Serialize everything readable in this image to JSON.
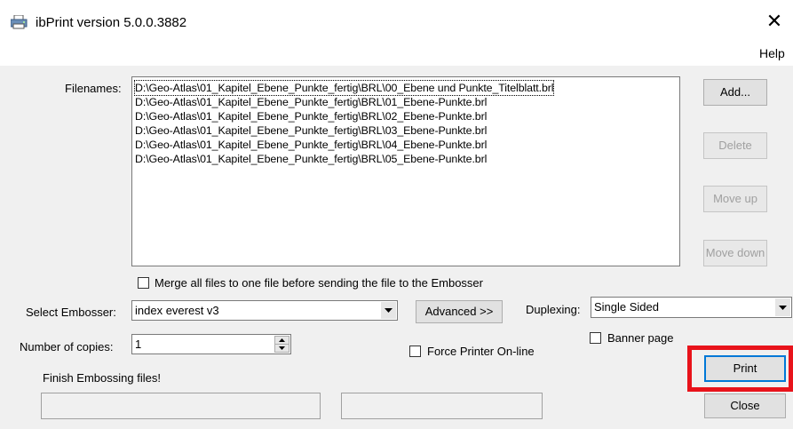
{
  "window": {
    "title": "ibPrint version 5.0.0.3882",
    "close_glyph": "✕"
  },
  "menu": {
    "help": "Help"
  },
  "filenames": {
    "label": "Filenames:",
    "items": [
      "D:\\Geo-Atlas\\01_Kapitel_Ebene_Punkte_fertig\\BRL\\00_Ebene und Punkte_Titelblatt.brl",
      "D:\\Geo-Atlas\\01_Kapitel_Ebene_Punkte_fertig\\BRL\\01_Ebene-Punkte.brl",
      "D:\\Geo-Atlas\\01_Kapitel_Ebene_Punkte_fertig\\BRL\\02_Ebene-Punkte.brl",
      "D:\\Geo-Atlas\\01_Kapitel_Ebene_Punkte_fertig\\BRL\\03_Ebene-Punkte.brl",
      "D:\\Geo-Atlas\\01_Kapitel_Ebene_Punkte_fertig\\BRL\\04_Ebene-Punkte.brl",
      "D:\\Geo-Atlas\\01_Kapitel_Ebene_Punkte_fertig\\BRL\\05_Ebene-Punkte.brl"
    ]
  },
  "buttons": {
    "add": "Add...",
    "delete": "Delete",
    "move_up": "Move up",
    "move_down": "Move down",
    "advanced": "Advanced >>",
    "print": "Print",
    "close": "Close"
  },
  "merge": {
    "label": "Merge all files to one file before sending the file to the Embosser",
    "checked": false
  },
  "embosser": {
    "label": "Select Embosser:",
    "value": "index everest v3"
  },
  "duplexing": {
    "label": "Duplexing:",
    "value": "Single Sided"
  },
  "copies": {
    "label": "Number of copies:",
    "value": "1"
  },
  "banner_page": {
    "label": "Banner page",
    "checked": false
  },
  "force_online": {
    "label": "Force Printer On-line",
    "checked": false
  },
  "status": {
    "text": "Finish Embossing files!"
  },
  "colors": {
    "highlight": "#e8131b"
  }
}
